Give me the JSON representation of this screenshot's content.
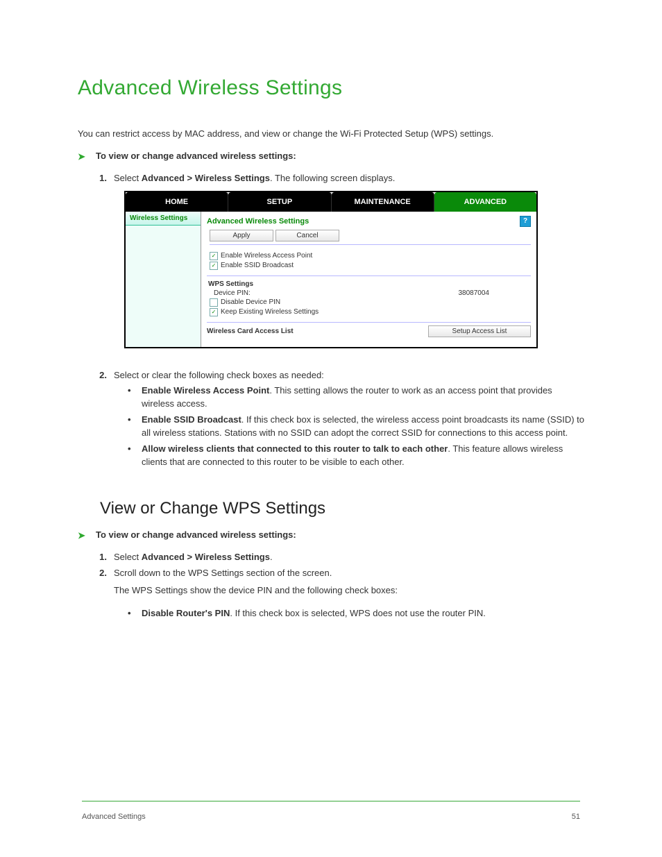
{
  "page": {
    "title": "Advanced Wireless Settings",
    "intro": "You can restrict access by MAC address, and view or change the Wi-Fi Protected Setup (WPS) settings.",
    "step_header": "To view or change advanced wireless settings:",
    "step1_num": "1.",
    "step1_a": "Select ",
    "step1_b": "Advanced > Wireless Settings",
    "step1_c": ". The following screen displays.",
    "tabs": {
      "home": "HOME",
      "setup": "SETUP",
      "maintenance": "MAINTENANCE",
      "advanced": "ADVANCED"
    },
    "sidebar_item": "Wireless Settings",
    "panel_title": "Advanced Wireless Settings",
    "apply_btn": "Apply",
    "cancel_btn": "Cancel",
    "chk_ap": "Enable Wireless Access Point",
    "chk_ssid": "Enable SSID Broadcast",
    "wps_title": "WPS Settings",
    "device_pin_label": "Device PIN:",
    "device_pin_value": "38087004",
    "chk_disable_pin": "Disable Device PIN",
    "chk_keep": "Keep Existing Wireless Settings",
    "access_label": "Wireless Card Access List",
    "access_btn": "Setup Access List",
    "step2_num": "2.",
    "step2_text": "Select or clear the following check boxes as needed:",
    "bullets": [
      {
        "b": "Enable Wireless Access Point",
        "t": ". This setting allows the router to work as an access point that provides wireless access."
      },
      {
        "b": "Enable SSID Broadcast",
        "t": ". If this check box is selected, the wireless access point broadcasts its name (SSID) to all wireless stations. Stations with no SSID can adopt the correct SSID for connections to this access point."
      },
      {
        "b": "Allow wireless clients that connected to this router to talk to each other",
        "t": ". This feature allows wireless clients that are connected to this router to be visible to each other."
      }
    ],
    "section2_title": "View or Change WPS Settings",
    "step_header2": "To view or change advanced wireless settings:",
    "steps2": [
      {
        "n": "1.",
        "a": "Select ",
        "b": "Advanced > Wireless Settings",
        "c": "."
      },
      {
        "n": "2.",
        "a": "Scroll down to the WPS Settings section of the screen."
      }
    ],
    "wps_intro": "The WPS Settings show the device PIN and the following check boxes:",
    "wps_bullets": [
      {
        "b": "Disable Router's PIN",
        "t": ". If this check box is selected, WPS does not use the router PIN."
      }
    ],
    "footer_left": "Advanced Settings",
    "footer_right": "51"
  }
}
